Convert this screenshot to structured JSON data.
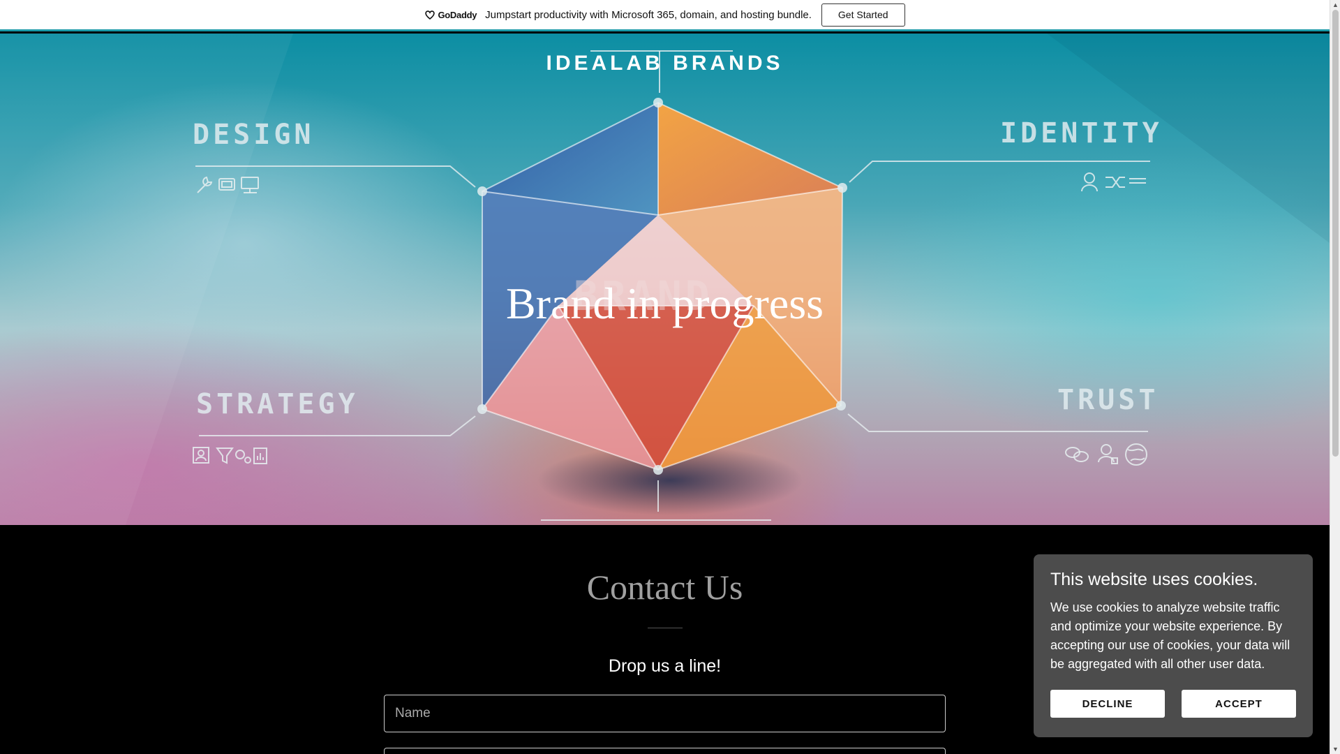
{
  "promo": {
    "logo_text": "GoDaddy",
    "text": "Jumpstart productivity with Microsoft 365, domain, and hosting bundle.",
    "button_label": "Get Started"
  },
  "hero": {
    "brand_name": "IDEALAB BRANDS",
    "title": "Brand in progress",
    "labels": {
      "design": "DESIGN",
      "identity": "IDENTITY",
      "strategy": "STRATEGY",
      "trust": "TRUST",
      "center": "BRAND"
    }
  },
  "contact": {
    "heading": "Contact Us",
    "subheading": "Drop us a line!",
    "name_placeholder": "Name"
  },
  "cookie_banner": {
    "title": "This website uses cookies.",
    "body": "We use cookies to analyze website traffic and optimize your website experience. By accepting our use of cookies, your data will be aggregated with all other user data.",
    "decline_label": "DECLINE",
    "accept_label": "ACCEPT"
  },
  "colors": {
    "accent_teal": "#1b9aa8",
    "cookie_bg": "#4c4c4c"
  }
}
